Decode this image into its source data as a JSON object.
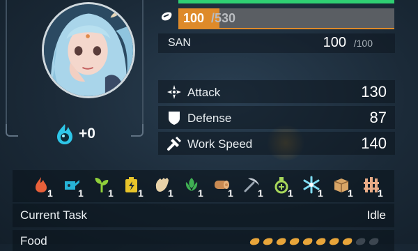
{
  "xp": {
    "current": "100",
    "max": "/530",
    "fraction": 0.19
  },
  "hp": {
    "fraction": 1.0
  },
  "san": {
    "label": "SAN",
    "value": "100",
    "max": "/100"
  },
  "stats": [
    {
      "icon": "attack-icon",
      "label": "Attack",
      "value": "130"
    },
    {
      "icon": "defense-icon",
      "label": "Defense",
      "value": "87"
    },
    {
      "icon": "work-speed-icon",
      "label": "Work Speed",
      "value": "140"
    }
  ],
  "soul": {
    "label": "+0"
  },
  "work_suitability": [
    {
      "icon": "kindling-icon",
      "level": "1",
      "color": "#e8603a"
    },
    {
      "icon": "watering-icon",
      "level": "1",
      "color": "#27b3d6"
    },
    {
      "icon": "planting-icon",
      "level": "1",
      "color": "#8fcf3a"
    },
    {
      "icon": "electricity-icon",
      "level": "1",
      "color": "#e8c42a"
    },
    {
      "icon": "handiwork-icon",
      "level": "1",
      "color": "#e8d2a8"
    },
    {
      "icon": "gathering-icon",
      "level": "1",
      "color": "#3fae53"
    },
    {
      "icon": "lumbering-icon",
      "level": "1",
      "color": "#c98a52"
    },
    {
      "icon": "mining-icon",
      "level": "1",
      "color": "#9aa6b2"
    },
    {
      "icon": "medicine-icon",
      "level": "1",
      "color": "#a6d65a"
    },
    {
      "icon": "cooling-icon",
      "level": "1",
      "color": "#7fdcf2"
    },
    {
      "icon": "transporting-icon",
      "level": "1",
      "color": "#d8a566"
    },
    {
      "icon": "farming-icon",
      "level": "1",
      "color": "#e8ab86"
    }
  ],
  "task": {
    "label": "Current Task",
    "value": "Idle"
  },
  "food": {
    "label": "Food",
    "filled": 8,
    "total": 10
  },
  "colors": {
    "xp": "#de8a2a",
    "hp": "#2fcf73",
    "soul": "#2ec6e8"
  }
}
